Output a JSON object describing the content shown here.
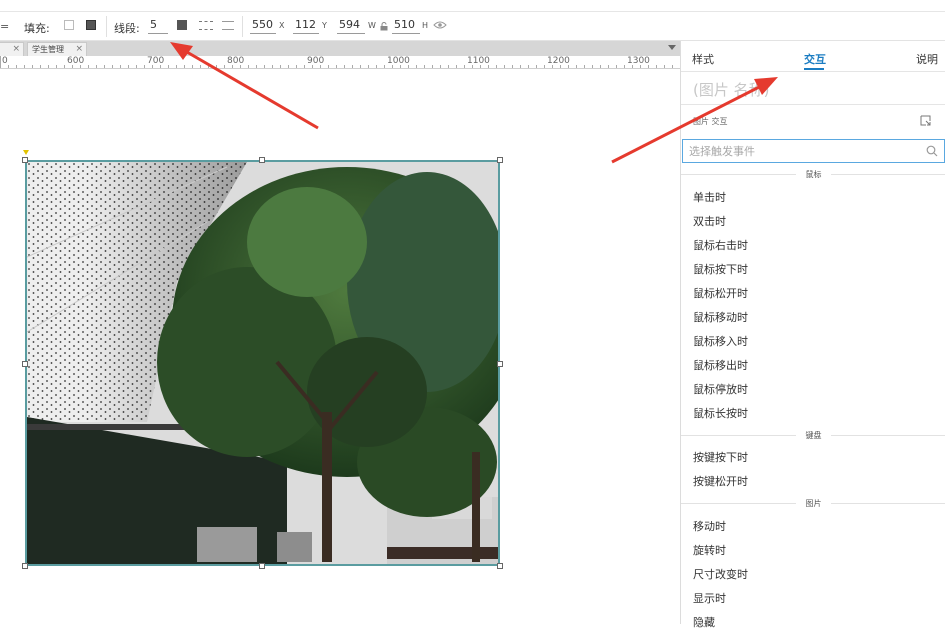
{
  "toolbar": {
    "fill_label": "填充:",
    "stroke_label": "线段:",
    "stroke_value": "5",
    "x_value": "550",
    "x_axis": "X",
    "y_value": "112",
    "y_axis": "Y",
    "w_value": "594",
    "w_axis": "W",
    "h_value": "510",
    "h_axis": "H"
  },
  "tabs": {
    "tab1_label": "学生管理",
    "close_glyph": "×"
  },
  "ruler": {
    "labels": [
      "0",
      "600",
      "700",
      "800",
      "900",
      "1000",
      "1100",
      "1200",
      "1300"
    ]
  },
  "panel": {
    "tab_style": "样式",
    "tab_interact": "交互",
    "tab_notes": "说明",
    "element_name": "(图片 名称)",
    "subtitle": "图片 交互",
    "search_placeholder": "选择触发事件",
    "section_mouse": "鼠标",
    "mouse_events": [
      "单击时",
      "双击时",
      "鼠标右击时",
      "鼠标按下时",
      "鼠标松开时",
      "鼠标移动时",
      "鼠标移入时",
      "鼠标移出时",
      "鼠标停放时",
      "鼠标长按时"
    ],
    "section_keyboard": "键盘",
    "keyboard_events": [
      "按键按下时",
      "按键松开时"
    ],
    "section_image": "图片",
    "image_events": [
      "移动时",
      "旋转时",
      "尺寸改变时",
      "显示时",
      "隐藏"
    ]
  },
  "colors": {
    "accent": "#1a7cc2",
    "arrow": "#e53a2e",
    "selection": "#5a9ca0"
  }
}
